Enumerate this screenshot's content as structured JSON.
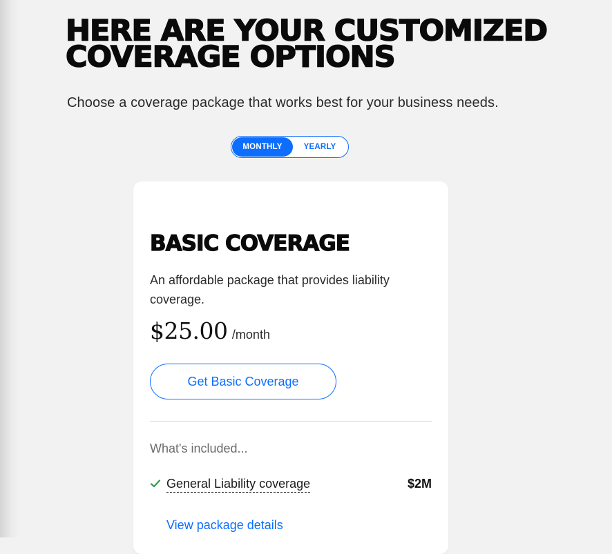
{
  "header": {
    "headline": "HERE ARE YOUR CUSTOMIZED COVERAGE OPTIONS",
    "subtitle": "Choose a coverage package that works best for your business needs."
  },
  "billing_toggle": {
    "options": [
      "MONTHLY",
      "YEARLY"
    ],
    "selected": "MONTHLY"
  },
  "package": {
    "title": "BASIC COVERAGE",
    "description": "An affordable package that provides liability coverage.",
    "price": "$25.00",
    "period": "/month",
    "cta_label": "Get Basic Coverage",
    "included_label": "What's included...",
    "features": [
      {
        "name": "General Liability coverage",
        "value": "$2M",
        "icon": "check-icon"
      }
    ],
    "details_link": "View package details"
  },
  "colors": {
    "accent": "#0d6efd",
    "check": "#2e9e4f",
    "background": "#f2f2f2",
    "card": "#ffffff"
  }
}
